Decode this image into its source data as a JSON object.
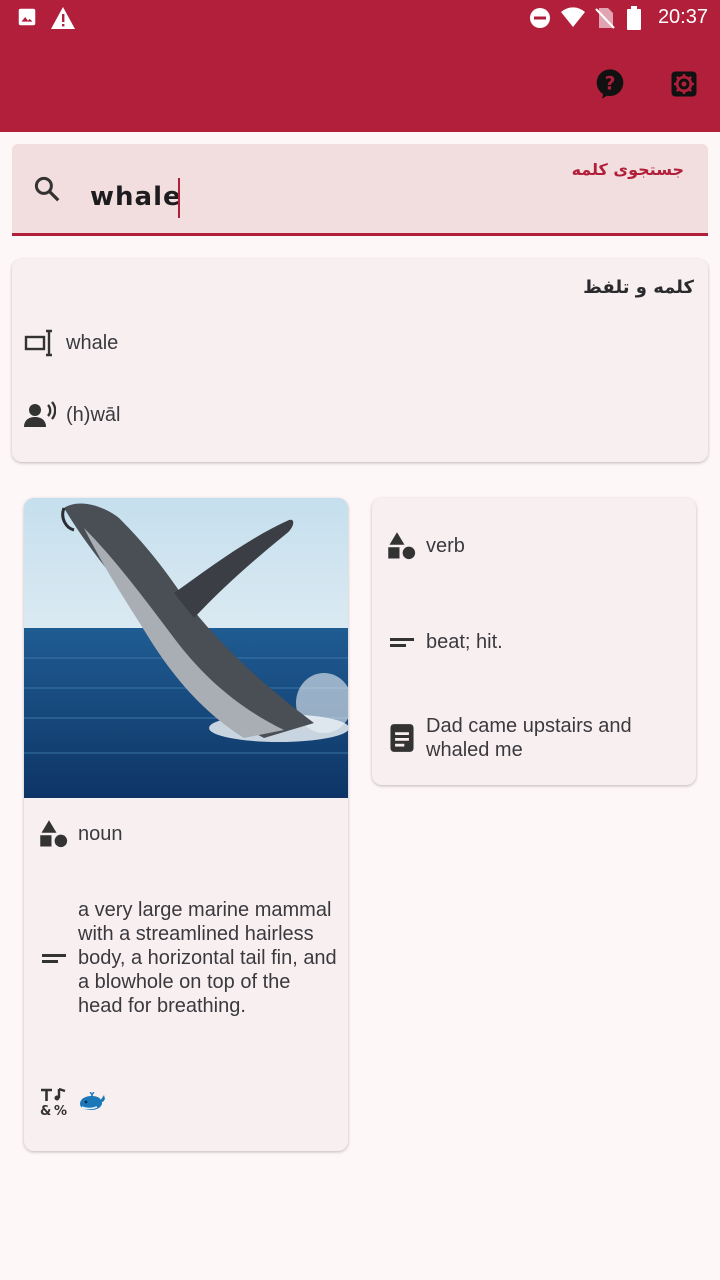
{
  "status_bar": {
    "time": "20:37",
    "icons": [
      "image-icon",
      "warning-icon",
      "do-not-disturb-icon",
      "wifi-icon",
      "no-sim-icon",
      "battery-icon"
    ]
  },
  "app_bar": {
    "actions": [
      "help-icon",
      "settings-icon"
    ]
  },
  "search": {
    "label": "جستجوی کلمه",
    "value": "whale",
    "icon": "search-icon"
  },
  "word_card": {
    "title": "کلمه و تلفظ",
    "word": "whale",
    "pronunciation": "(h)wāl"
  },
  "definitions": [
    {
      "part_of_speech": "noun",
      "definition": "a very large marine mammal with a streamlined hairless body, a horizontal tail fin, and a blowhole on top of the head for breathing.",
      "emoji": "🐋",
      "image": "breaching-whale-photo"
    },
    {
      "part_of_speech": "verb",
      "definition": "beat; hit.",
      "example": "Dad came upstairs and whaled me"
    }
  ],
  "colors": {
    "primary": "#b21f3a",
    "search_bg": "#f2dede",
    "card_bg": "#f8eff1",
    "page_bg": "#fdf7f8"
  }
}
